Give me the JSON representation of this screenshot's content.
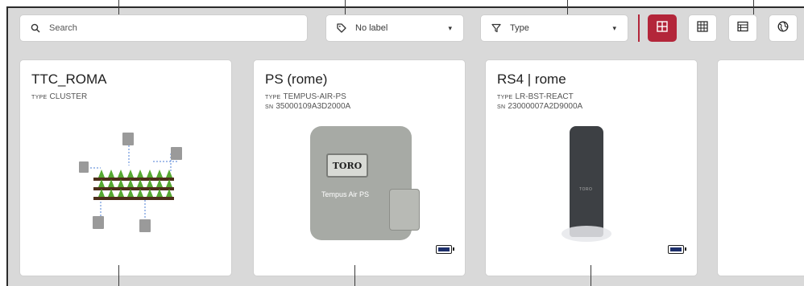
{
  "toolbar": {
    "search_placeholder": "Search",
    "label_filter": "No label",
    "type_filter": "Type"
  },
  "view_modes": [
    {
      "icon": "large-grid-icon",
      "active": true
    },
    {
      "icon": "small-grid-icon",
      "active": false
    },
    {
      "icon": "list-table-icon",
      "active": false
    },
    {
      "icon": "globe-icon",
      "active": false
    }
  ],
  "type_key": "TYPE",
  "sn_key": "SN",
  "cards": [
    {
      "title": "TTC_ROMA",
      "type": "CLUSTER",
      "image": "cluster-diagram"
    },
    {
      "title": "PS (rome)",
      "type": "TEMPUS-AIR-PS",
      "sn": "35000109A3D2000A",
      "image": "tempus-air-ps-device",
      "battery": "full"
    },
    {
      "title": "RS4 | rome",
      "type": "LR-BST-REACT",
      "sn": "23000007A2D9000A",
      "image": "lr-bst-react-sensor",
      "battery": "full"
    }
  ],
  "device_images": {
    "brand_text": "TORO",
    "ps_model_text": "Tempus Air PS",
    "sensor_brand_text": "TORO"
  },
  "colors": {
    "accent": "#b3263a",
    "background": "#d9d9d9",
    "card": "#ffffff",
    "battery_fill": "#1d2f6b"
  }
}
